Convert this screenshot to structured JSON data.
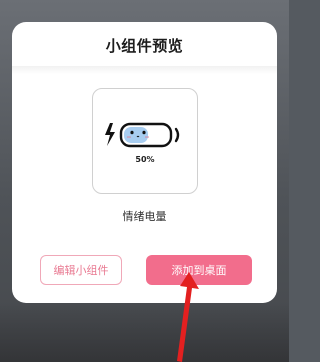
{
  "dialog": {
    "title": "小组件预览",
    "widget": {
      "battery_percent": "50%",
      "name": "情绪电量"
    },
    "buttons": {
      "edit_label": "编辑小组件",
      "add_label": "添加到桌面"
    }
  },
  "colors": {
    "accent": "#f26d8c",
    "accent_outline": "#f0a8b8",
    "annotation_arrow": "#e32020"
  }
}
